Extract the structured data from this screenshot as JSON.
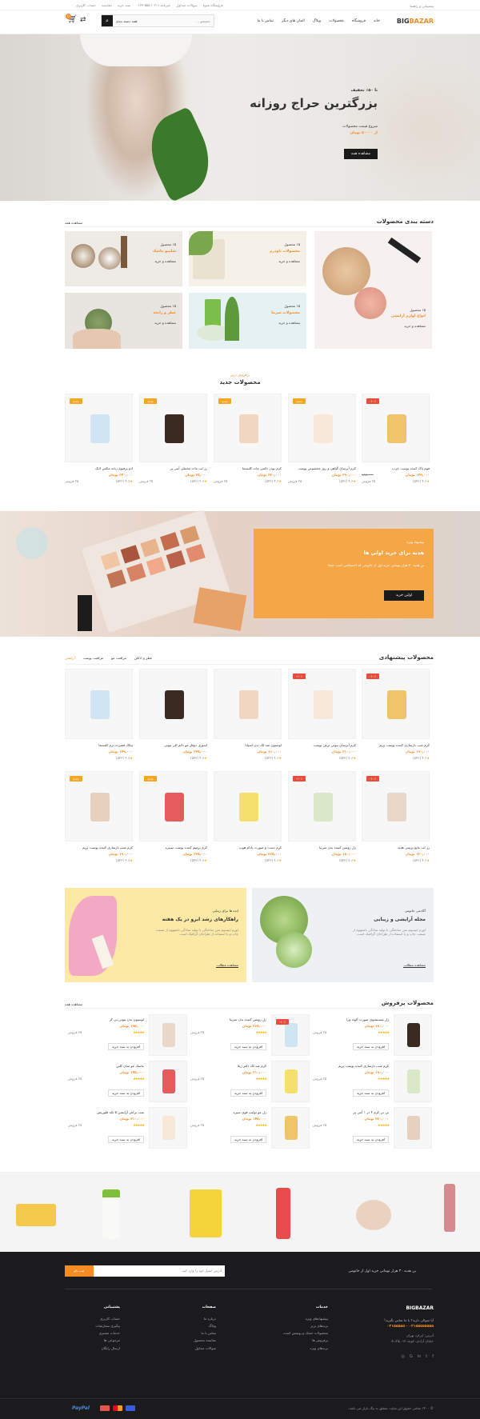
{
  "topbar": {
    "login": "پشتیبانی و راهنما",
    "links": [
      "فروشگاه شوپا",
      "سوالات متداول",
      "خبرنامه (۰۲۱) ۵۵۵-۰۱۲۳",
      "سبد خرید",
      "مقایسه",
      "حساب کاربری"
    ]
  },
  "header": {
    "logo_a": "BIG",
    "logo_b": "BAZAR",
    "nav": [
      "خانه",
      "فروشگاه",
      "محصولات",
      "وبلاگ",
      "المان های دیگر",
      "تماس با ما"
    ],
    "search_placeholder": "جستجو ...",
    "category_select": "همه دسته بندی",
    "cart_count": "0"
  },
  "hero": {
    "pre": "تا ۵۰٪ تخفیف",
    "title": "بزرگترین حراج روزانه",
    "sub": "شروع قیمت محصولات",
    "price": "از ۵۰۰۰۰ تومان",
    "cta": "مشاهده همه"
  },
  "categories": {
    "title": "دسته بندی محصولات",
    "view_all": "مشاهده همه",
    "items": [
      {
        "count": "۱۵ محصول",
        "name": "انواع لوازم آرایشی",
        "link": "مشاهده و خرید"
      },
      {
        "count": "۱۵ محصول",
        "name": "محصولات ناودرم",
        "link": "مشاهده و خرید"
      },
      {
        "count": "۱۵ محصول",
        "name": "شامپو ماسک",
        "link": "مشاهده و خرید"
      },
      {
        "count": "۱۵ محصول",
        "name": "محصولات سرینا",
        "link": "مشاهده و خرید"
      },
      {
        "count": "۱۵ محصول",
        "name": "عطر و رایحه",
        "link": "مشاهده و خرید"
      }
    ]
  },
  "new_products": {
    "kicker": "پرفروش ترین",
    "title": "محصولات جدید",
    "items": [
      {
        "name": "فوم پاک کننده پوست چرب",
        "price": "۱۴۹,۰۰۰ تومان",
        "old": "۱۸۵,۰۰۰",
        "rating": "۴.۶ (۵۴۳)",
        "sold": "۲۵ فروش",
        "badge": "۱۰٪-"
      },
      {
        "name": "کرم آبرسان گیاهی و روز مخصوص پوست",
        "price": "۲۹۰,۰۰۰ تومان",
        "old": "",
        "rating": "۴.۶ (۵۴۳)",
        "sold": "۲۵ فروش",
        "badge": "جدید"
      },
      {
        "name": "کرم پودر دائمی مات کلیسما",
        "price": "۳۲۰,۰۰۰ تومان",
        "old": "",
        "rating": "۴.۶ (۵۴۳)",
        "sold": "۲۵ فروش",
        "badge": "جدید"
      },
      {
        "name": "رژ لب مات مخملی آنتی پر",
        "price": "۲۵,۰۰۰ تومان",
        "old": "",
        "rating": "۴.۶ (۵۴۳)",
        "sold": "۲۵ فروش",
        "badge": "جدید"
      },
      {
        "name": "ادو پرفیوم زنانه مکس لایک",
        "price": "۲۴۰,۰۰۰ تومان",
        "old": "",
        "rating": "۴.۶ (۵۴۳)",
        "sold": "۲۵ فروش",
        "badge": "جدید"
      }
    ]
  },
  "promo": {
    "kicker": "پیشنهاد ویژه",
    "title": "هدیه برای خرید اولی ها",
    "text": "بن هدیه ۳۰ هزار تومانی خرید اول از خانومی که اختصاصی است شما. ",
    "cta": "اولین خرید"
  },
  "featured": {
    "title": "محصولات پیشنهادی",
    "tabs": [
      "آرایشی",
      "مراقبت پوست",
      "مراقبت مو",
      "عطر و ادکلن"
    ],
    "items": [
      {
        "name": "کرم شب بازسازی کننده پوست پریم",
        "price": "۱۹۰,۰۰۰ تومان",
        "rating": "۴.۶ (۵۴۳)",
        "badge": "۱۰٪-"
      },
      {
        "name": "کرم آبرسان بیوتی ترش پوست",
        "price": "۲۱۰,۰۰۰ تومان",
        "rating": "۴.۶ (۵۴۳)",
        "badge": "۱۰٪-"
      },
      {
        "name": "لوسیون ضد لک بدن اسپانا",
        "price": "۱۱۰,۰۰۰ تومان",
        "rating": "۴.۶ (۵۴۳)",
        "badge": ""
      },
      {
        "name": "اسپری دوفاز مو دائم الی بیوتی",
        "price": "۲۴۵,۰۰۰ تومان",
        "rating": "۴.۶ (۵۴۳)",
        "badge": ""
      },
      {
        "name": "پنکک فشرده نرم کلیسما",
        "price": "۱۴۹,۰۰۰ تومان",
        "rating": "۴.۶ (۵۴۳)",
        "badge": ""
      },
      {
        "name": "رژ لب مایع پرینتی هدیه",
        "price": "۱۲۰,۰۰۰ تومان",
        "rating": "۴.۶ (۵۴۳)",
        "badge": "۱۰٪-"
      },
      {
        "name": "ژل روشن کننده بدن سرینا",
        "price": "۱۸۰,۰۰۰ تومان",
        "rating": "۴.۶ (۵۴۳)",
        "badge": "۱۰٪-"
      },
      {
        "name": "کرم دست و صورت بادام هوپ",
        "price": "۲۶۵,۰۰۰ تومان",
        "rating": "۴.۶ (۵۴۳)",
        "badge": ""
      },
      {
        "name": "کرم ترمیم کننده پوست سینره",
        "price": "۲۲۵,۰۰۰ تومان",
        "rating": "۴.۶ (۵۴۳)",
        "badge": "جدید"
      },
      {
        "name": "کرم شب بازسازی کننده پوست پریم",
        "price": "۱۹۰,۰۰۰ تومان",
        "rating": "۴.۶ (۵۴۳)",
        "badge": "جدید"
      }
    ]
  },
  "banners": [
    {
      "kicker": "آکادمی خانومی",
      "title": "مجله آرایشی و زیبایی",
      "text": "لورم ایپسوم متن ساختگی با تولید سادگی نامفهوم از صنعت چاپ و با استفاده از طراحان گرافیک است.",
      "link": "مشاهده مطالب"
    },
    {
      "kicker": "ایده ها برای زیبایی",
      "title": "راهکارهای رشد ابرو در یک هفته",
      "text": "لورم ایپسوم متن ساختگی با تولید سادگی نامفهوم از صنعت چاپ و با استفاده از طراحان گرافیک است.",
      "link": "مشاهده مطالب"
    }
  ],
  "bestsellers": {
    "title": "محصولات پرفروش",
    "view_all": "مشاهده همه",
    "items": [
      {
        "name": "ژل شستشوی صورت آلوئه ورا",
        "price": "۱۸۰,۰۰۰ تومان",
        "sold": "۲۵ فروش",
        "cart": "افزودن به سبد خرید",
        "badge": ""
      },
      {
        "name": "ژل روشن کننده بدن سرینا",
        "price": "۲۶۵,۰۰۰ تومان",
        "sold": "۲۵ فروش",
        "cart": "افزودن به سبد خرید",
        "badge": "۱۰٪-"
      },
      {
        "name": "لوسیون بدن بیوتی بی کر",
        "price": "۱۹۵,۰۰۰ تومان",
        "sold": "۲۵ فروش",
        "cart": "افزودن به سبد خرید",
        "badge": ""
      },
      {
        "name": "کرم شب بازسازی کننده پوست پریم",
        "price": "۱۹۰,۰۰۰ تومان",
        "sold": "۲۵ فروش",
        "cart": "افزودن به سبد خرید",
        "badge": ""
      },
      {
        "name": "کرم ضد لک دکتر ژیلا",
        "price": "۲۱۰,۰۰۰ تومان",
        "sold": "۲۵ فروش",
        "cart": "افزودن به سبد خرید",
        "badge": ""
      },
      {
        "name": "ماسک مو سان کلین",
        "price": "۱۷۵,۰۰۰ تومان",
        "sold": "۲۵ فروش",
        "cart": "افزودن به سبد خرید",
        "badge": ""
      },
      {
        "name": "بی بی کرم ۴ در ۱ آنتی پر",
        "price": "۲۳۰,۰۰۰ تومان",
        "sold": "۲۵ فروش",
        "cart": "افزودن به سبد خرید",
        "badge": ""
      },
      {
        "name": "ژل مو تولیپ قوی سیره",
        "price": "۱۴۵,۰۰۰ تومان",
        "sold": "۲۵ فروش",
        "cart": "افزودن به سبد خرید",
        "badge": ""
      },
      {
        "name": "ست براش آرایشی ۵ تکه فلوریش",
        "price": "۳۱۰,۰۰۰ تومان",
        "sold": "۲۵ فروش",
        "cart": "افزودن به سبد خرید",
        "badge": ""
      }
    ]
  },
  "newsletter": {
    "gift": "بن هدیه ۳۰ هزار تومانی خرید اول از خانومی",
    "label": "از جدیدترین تخفیف ها باخبر شوید",
    "placeholder": "آدرس ایمیل خود را وارد کنید",
    "button": "ثبت نام"
  },
  "footer": {
    "logo": "BIGBAZAR",
    "question": "آیا سوالی دارید؟ با ما تماس بگیرید!",
    "phone": "۰۲۱۵۵۵۵۵۵۵۵ - ۰۲۱۵۵۵۵۵",
    "address": "آدرس: ایران، تهران",
    "address2": "خیابان آزادی، کوچه ۱۲، پلاک ۵",
    "col1": {
      "title": "خدمات",
      "items": [
        "پیشنهادهای ویژه",
        "برندهای برتر",
        "محصولات خشک و پوشش کننده",
        "پرفروش ها",
        "برندهای ویژه"
      ]
    },
    "col2": {
      "title": "صفحات",
      "items": [
        "درباره ما",
        "وبلاگ",
        "تماس با ما",
        "مقایسه محصول",
        "سوالات متداول"
      ]
    },
    "col3": {
      "title": "پشتیبانی",
      "items": [
        "حساب کاربری",
        "پیگیری سفارشات",
        "خدمات مشتری",
        "مرجوعی ها",
        "ارسال رایگان"
      ]
    },
    "copyright": "© ۱۴۰۰ تمامی حقوق این سایت متعلق به بیگ بازار می باشد.",
    "pay": "PayPal"
  }
}
